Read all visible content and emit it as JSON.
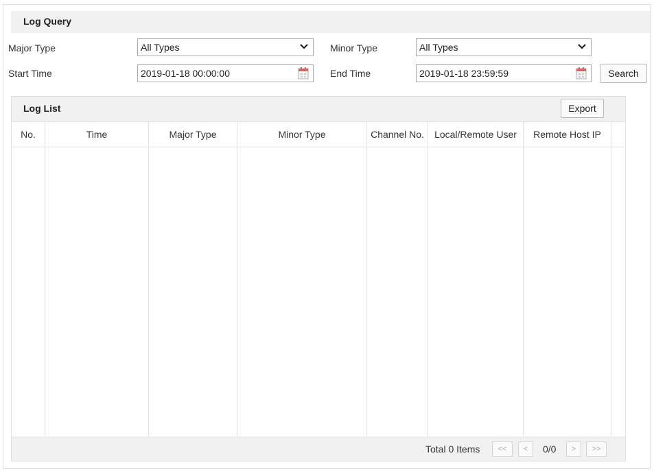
{
  "query": {
    "title": "Log Query",
    "major_type_label": "Major Type",
    "major_type_value": "All Types",
    "minor_type_label": "Minor Type",
    "minor_type_value": "All Types",
    "start_time_label": "Start Time",
    "start_time_value": "2019-01-18 00:00:00",
    "end_time_label": "End Time",
    "end_time_value": "2019-01-18 23:59:59",
    "search_label": "Search"
  },
  "log_list": {
    "title": "Log List",
    "export_label": "Export",
    "columns": [
      "No.",
      "Time",
      "Major Type",
      "Minor Type",
      "Channel No.",
      "Local/Remote User",
      "Remote Host IP"
    ],
    "rows": []
  },
  "pagination": {
    "total_text": "Total 0 Items",
    "first_label": "<<",
    "prev_label": "<",
    "page_text": "0/0",
    "next_label": ">",
    "last_label": ">>"
  },
  "icons": {
    "dropdown": "chevron-down-icon",
    "date_picker": "calendar-icon"
  }
}
